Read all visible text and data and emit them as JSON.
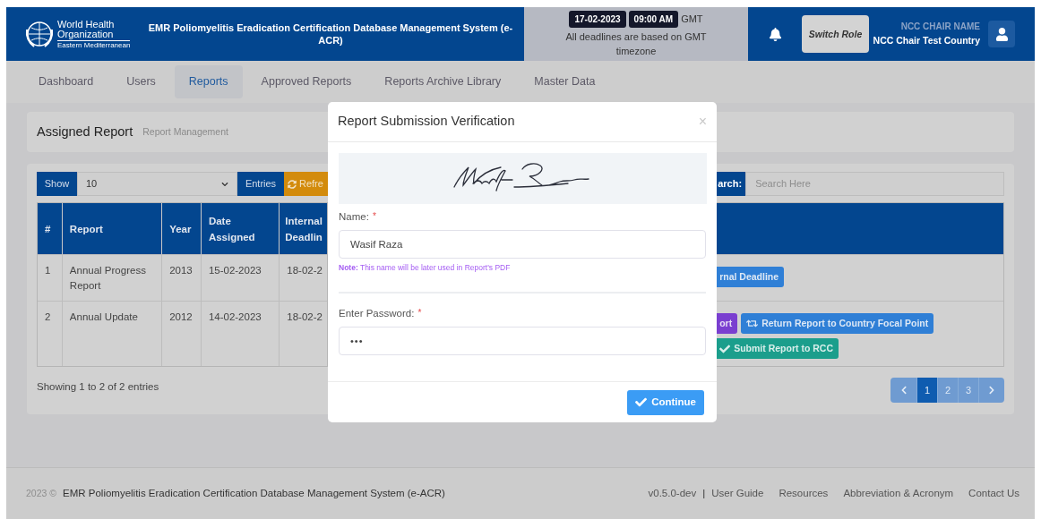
{
  "header": {
    "logo_lines": [
      "World Health",
      "Organization"
    ],
    "logo_region": "Eastern Mediterranean",
    "title": "EMR Poliomyelitis Eradication Certification Database Management System (e-ACR)",
    "date": "17-02-2023",
    "time": "09:00 AM",
    "timezone": "GMT",
    "deadline_note": "All deadlines are based on GMT timezone",
    "switch_role": "Switch Role",
    "user_caption": "NCC CHAIR NAME",
    "user_name": "NCC Chair Test Country"
  },
  "nav": [
    {
      "label": "Dashboard",
      "selected": false
    },
    {
      "label": "Users",
      "selected": false
    },
    {
      "label": "Reports",
      "selected": true
    },
    {
      "label": "Approved Reports",
      "selected": false
    },
    {
      "label": "Reports Archive Library",
      "selected": false
    },
    {
      "label": "Master Data",
      "selected": false
    }
  ],
  "page_header": {
    "title": "Assigned Report",
    "subtitle": "Report Management"
  },
  "toolbar": {
    "show": "Show",
    "page_size": "10",
    "entries": "Entries",
    "refresh": "Refre",
    "search_label": "arch:",
    "search_placeholder": "Search Here"
  },
  "table": {
    "columns": [
      "#",
      "Report",
      "Year",
      "Date Assigned",
      "Internal Deadlin"
    ],
    "rows": [
      {
        "number": "1",
        "report": "Annual Progress Report",
        "year": "2013",
        "date_assigned": "15-02-2023",
        "internal_deadline": "18-02-2",
        "actions": [
          {
            "kind": "extend",
            "label": "rnal Deadline"
          }
        ]
      },
      {
        "number": "2",
        "report": "Annual Update",
        "year": "2012",
        "date_assigned": "14-02-2023",
        "internal_deadline": "18-02-2",
        "actions": [
          {
            "kind": "view",
            "label": "ort"
          },
          {
            "kind": "return",
            "label": "Return Report to Country Focal Point"
          },
          {
            "kind": "submit",
            "label": "Submit Report to RCC"
          }
        ]
      }
    ]
  },
  "summary": "Showing 1 to 2 of 2 entries",
  "pagination": [
    {
      "label": "1",
      "selected": true
    },
    {
      "label": "2",
      "selected": false
    },
    {
      "label": "3",
      "selected": false
    }
  ],
  "footer": {
    "year": "2023 ©",
    "system": "EMR Poliomyelitis Eradication Certification Database Management System (e-ACR)",
    "version": "v0.5.0-dev",
    "separator": "|",
    "links": [
      "User Guide",
      "Resources",
      "Abbreviation & Acronym",
      "Contact Us"
    ]
  },
  "modal": {
    "title": "Report Submission Verification",
    "close": "×",
    "fields": [
      {
        "kind": "text",
        "label": "Name:",
        "mark": "*",
        "value": "Wasif Raza",
        "note": "**Note:** This name will be later used in Report's PDF"
      },
      {
        "kind": "password",
        "label": "Enter Password:",
        "mark": "*",
        "value": "•••"
      }
    ],
    "continue": "Continue"
  }
}
